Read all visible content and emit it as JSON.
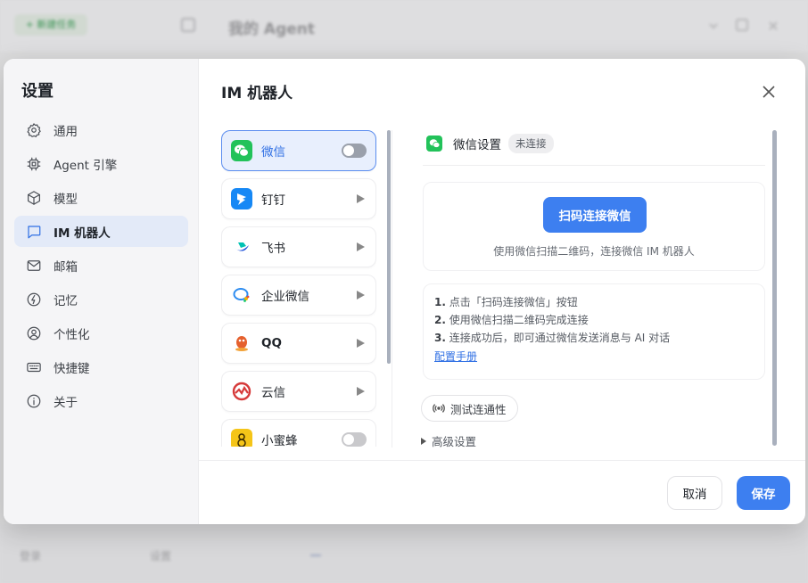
{
  "background": {
    "new_button": "+ 新建任务",
    "title": "我的 Agent",
    "bottom_left": "登录",
    "bottom_mid": "设置"
  },
  "settings": {
    "title": "设置",
    "nav": [
      {
        "label": "通用",
        "icon": "gear-icon"
      },
      {
        "label": "Agent 引擎",
        "icon": "cpu-icon"
      },
      {
        "label": "模型",
        "icon": "cube-icon"
      },
      {
        "label": "IM 机器人",
        "icon": "chat-bubble-icon",
        "active": true
      },
      {
        "label": "邮箱",
        "icon": "mail-icon"
      },
      {
        "label": "记忆",
        "icon": "memory-icon"
      },
      {
        "label": "个性化",
        "icon": "user-circle-icon"
      },
      {
        "label": "快捷键",
        "icon": "keyboard-icon"
      },
      {
        "label": "关于",
        "icon": "info-icon"
      }
    ]
  },
  "main": {
    "title": "IM 机器人",
    "providers": [
      {
        "name": "微信",
        "control": "toggle"
      },
      {
        "name": "钉钉",
        "control": "arrow"
      },
      {
        "name": "飞书",
        "control": "arrow"
      },
      {
        "name": "企业微信",
        "control": "arrow"
      },
      {
        "name": "QQ",
        "control": "arrow"
      },
      {
        "name": "云信",
        "control": "arrow"
      },
      {
        "name": "小蜜蜂",
        "control": "toggle"
      }
    ],
    "detail": {
      "title": "微信设置",
      "status": "未连接",
      "connect_button": "扫码连接微信",
      "connect_hint": "使用微信扫描二维码，连接微信 IM 机器人",
      "steps": [
        {
          "num": "1.",
          "text": "点击「扫码连接微信」按钮"
        },
        {
          "num": "2.",
          "text": "使用微信扫描二维码完成连接"
        },
        {
          "num": "3.",
          "text": "连接成功后，即可通过微信发送消息与 AI 对话"
        }
      ],
      "manual_link": "配置手册",
      "test_button": "测试连通性",
      "advanced": "高级设置"
    }
  },
  "footer": {
    "cancel": "取消",
    "save": "保存"
  },
  "colors": {
    "accent": "#3d7ff0",
    "active_nav_bg": "#e3eaf8",
    "wechat_green": "#22c25a"
  }
}
